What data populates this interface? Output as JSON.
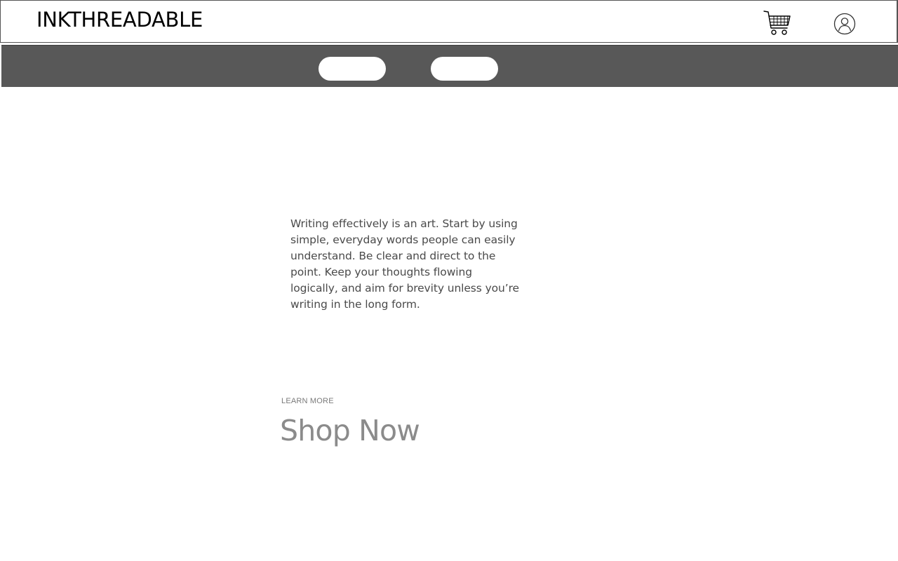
{
  "header": {
    "logo_text": "INKTHREADABLE",
    "icons": [
      "cart-icon",
      "account-icon"
    ]
  },
  "navbar": {
    "background": "#585858",
    "pills": [
      {
        "label": ""
      },
      {
        "label": ""
      }
    ]
  },
  "main": {
    "body_text": "Writing effectively is an art. Start by using simple, everyday words people can easily understand. Be clear and direct to the point. Keep your thoughts flowing logically, and aim for brevity unless you’re writing in the long form.",
    "learn_more": "LEARN MORE",
    "shop_now": "Shop Now"
  }
}
